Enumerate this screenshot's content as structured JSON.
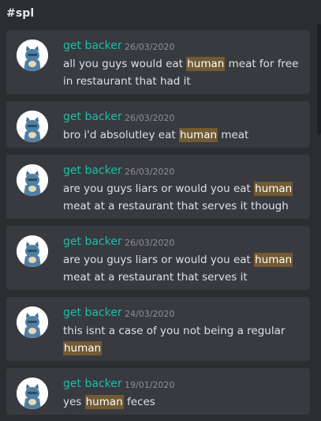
{
  "channel": "#spl",
  "colors": {
    "background": "#2b2d31",
    "card": "#383a40",
    "username": "#1dbfa6",
    "highlight": "#725a33"
  },
  "avatar_icon": "blue-bear-avatar-icon",
  "messages": [
    {
      "username": "get backer",
      "timestamp": "26/03/2020",
      "text_before": "all you guys would eat ",
      "highlight": "human",
      "text_after": " meat for free in restaurant that had it"
    },
    {
      "username": "get backer",
      "timestamp": "26/03/2020",
      "text_before": "bro i'd absolutley eat ",
      "highlight": "human",
      "text_after": " meat"
    },
    {
      "username": "get backer",
      "timestamp": "26/03/2020",
      "text_before": "are you guys liars or would you eat ",
      "highlight": "human",
      "text_after": " meat at a restaurant that serves it though"
    },
    {
      "username": "get backer",
      "timestamp": "26/03/2020",
      "text_before": "are you guys liars or would you eat ",
      "highlight": "human",
      "text_after": " meat at a restaurant that serves it"
    },
    {
      "username": "get backer",
      "timestamp": "24/03/2020",
      "text_before": "this isnt a case of you not being a regular ",
      "highlight": "human",
      "text_after": ""
    },
    {
      "username": "get backer",
      "timestamp": "19/01/2020",
      "text_before": "yes ",
      "highlight": "human",
      "text_after": " feces"
    }
  ]
}
